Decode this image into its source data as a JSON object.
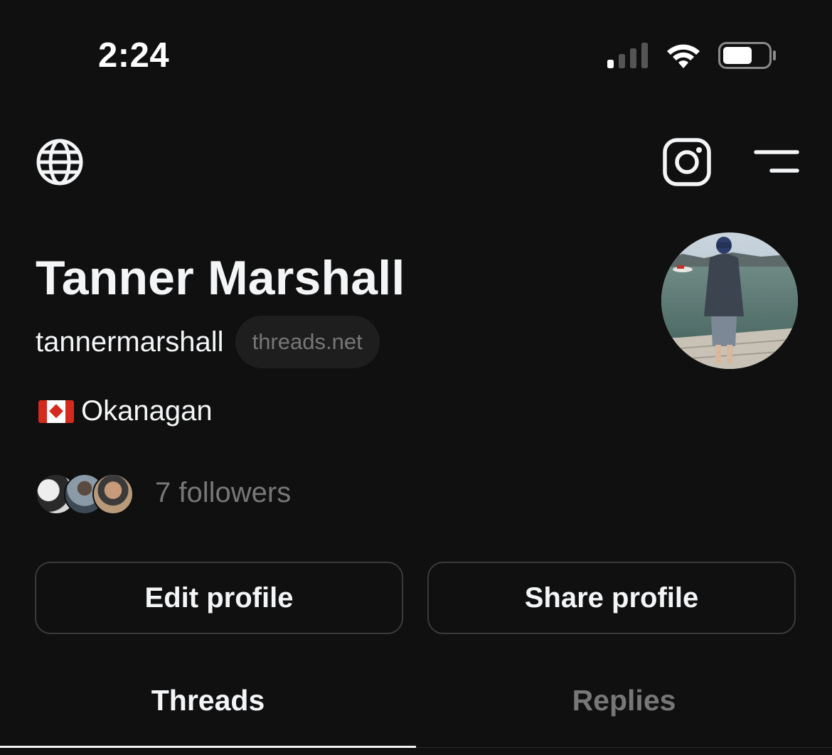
{
  "status_bar": {
    "time": "2:24",
    "icons": [
      "cellular-signal-icon",
      "wifi-icon",
      "battery-icon"
    ],
    "battery_level": 0.6
  },
  "top_bar": {
    "left_icon": "globe-icon",
    "right_icons": [
      "instagram-icon",
      "menu-icon"
    ]
  },
  "profile": {
    "name": "Tanner Marshall",
    "username": "tannermarshall",
    "domain_badge": "threads.net",
    "bio_flag": "canada-flag",
    "bio_text": "Okanagan",
    "followers_text": "7 followers",
    "avatar": "profile-photo"
  },
  "actions": {
    "edit_label": "Edit profile",
    "share_label": "Share profile"
  },
  "tabs": [
    {
      "label": "Threads",
      "active": true
    },
    {
      "label": "Replies",
      "active": false
    }
  ],
  "colors": {
    "background": "#101010",
    "primary_text": "#f3f5f7",
    "secondary_text": "#777777",
    "border": "#3a3a3a",
    "pill_background": "#1e1e1e"
  }
}
